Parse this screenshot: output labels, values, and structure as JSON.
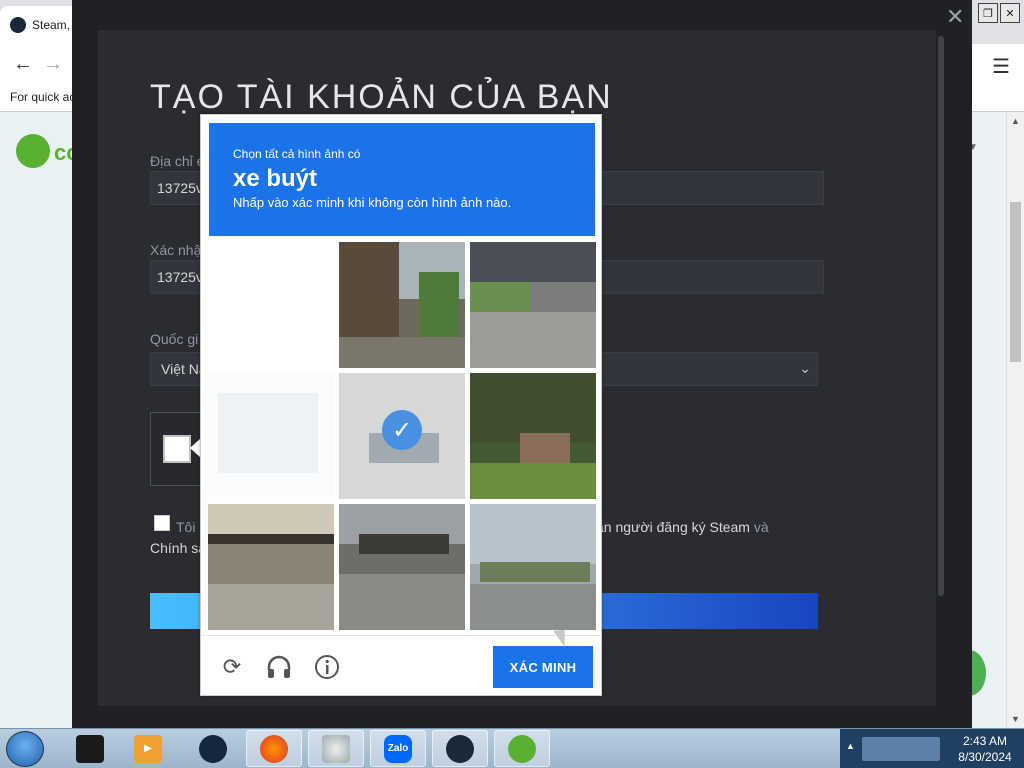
{
  "browser": {
    "tab_title": "Steam, T",
    "bookmarks_text": "For quick ac",
    "menu_icon": "hamburger-icon"
  },
  "background_site": {
    "logo_text": "cc"
  },
  "steam_dialog": {
    "title": "TẠO TÀI KHOẢN CỦA BẠN",
    "email_label": "Địa chỉ e",
    "email_value": "13725v",
    "confirm_label": "Xác nhậ",
    "confirm_value": "13725v",
    "country_label": "Quốc gi",
    "country_value": "Việt Na",
    "terms_text_left": "Tôi ",
    "terms_text_right": "ận người đăng ký Steam",
    "terms_text_and": " và",
    "terms_text_line2": "Chính sá"
  },
  "captcha": {
    "instruction_top": "Chọn tất cả hình ảnh có",
    "target": "xe buýt",
    "instruction_bottom": "Nhấp vào xác minh khi không còn hình ảnh nào.",
    "verify_label": "XÁC MINH",
    "tiles": [
      {
        "name": "tile-1",
        "state": "blank"
      },
      {
        "name": "tile-2",
        "state": "image"
      },
      {
        "name": "tile-3",
        "state": "image"
      },
      {
        "name": "tile-4",
        "state": "blank"
      },
      {
        "name": "tile-5",
        "state": "selected"
      },
      {
        "name": "tile-6",
        "state": "image"
      },
      {
        "name": "tile-7",
        "state": "image"
      },
      {
        "name": "tile-8",
        "state": "image"
      },
      {
        "name": "tile-9",
        "state": "image"
      }
    ],
    "footer_icons": [
      "reload-icon",
      "audio-icon",
      "info-icon"
    ],
    "accent": "#1a73e8"
  },
  "taskbar": {
    "apps": [
      "terminal-icon",
      "media-player-icon",
      "steam-dark-icon",
      "firefox-icon",
      "disc-icon",
      "zalo-icon",
      "steam-icon",
      "coccoc-icon"
    ],
    "zalo_label": "Zalo",
    "time": "2:43 AM",
    "date": "8/30/2024"
  }
}
